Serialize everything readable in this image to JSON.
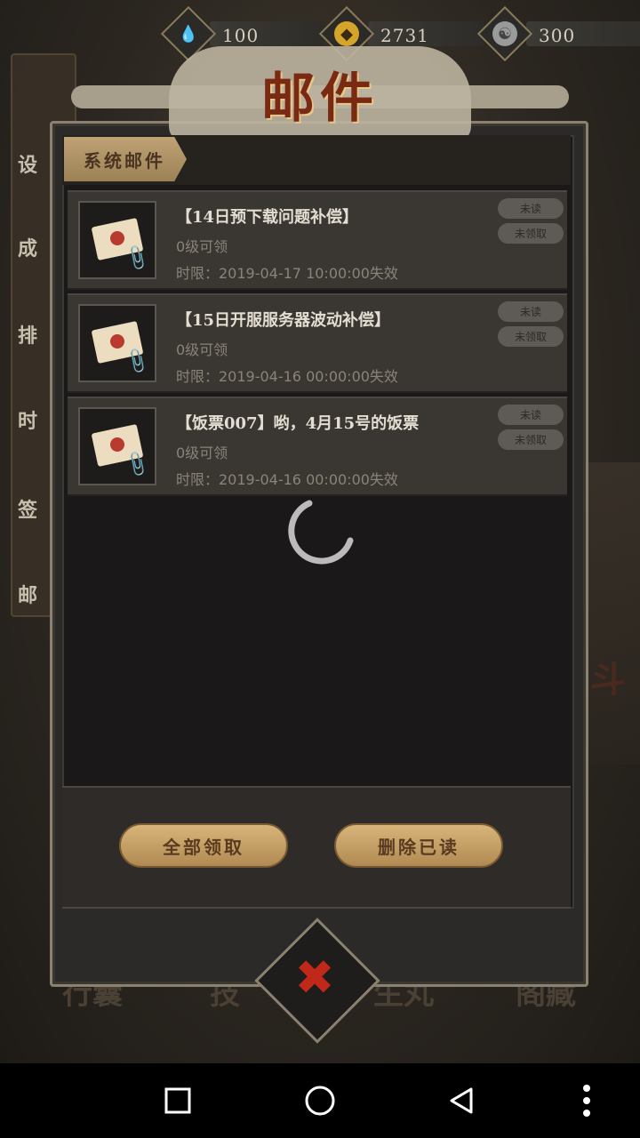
{
  "resources": [
    {
      "name": "stamina",
      "icon": "leaf-drop-icon",
      "value": "100",
      "color": "#3fbf3a"
    },
    {
      "name": "coins",
      "icon": "coin-icon",
      "value": "2731",
      "color": "#d4a52a"
    },
    {
      "name": "jade",
      "icon": "jade-icon",
      "value": "300",
      "color": "#bdbdbd"
    }
  ],
  "title": "邮件",
  "tab_label": "系统邮件",
  "mails": [
    {
      "subject": "【14日预下载问题补偿】",
      "level": "0级可领",
      "expire": "时限：2019-04-17 10:00:00失效",
      "read_status": "未读",
      "claim_status": "未领取"
    },
    {
      "subject": "【15日开服服务器波动补偿】",
      "level": "0级可领",
      "expire": "时限：2019-04-16 00:00:00失效",
      "read_status": "未读",
      "claim_status": "未领取"
    },
    {
      "subject": "【饭票007】哟，4月15号的饭票",
      "level": "0级可领",
      "expire": "时限：2019-04-16 00:00:00失效",
      "read_status": "未读",
      "claim_status": "未领取"
    }
  ],
  "buttons": {
    "claim_all": "全部领取",
    "delete_read": "删除已读"
  },
  "background": {
    "left_menu": [
      "设",
      "成",
      "排",
      "时",
      "签",
      "邮"
    ],
    "bottom_labels": [
      "行囊",
      "技",
      "生丸",
      "阁藏"
    ],
    "right_char": "斗"
  },
  "colors": {
    "title": "#7a2a12",
    "button": "#c9a266",
    "close": "#c0281a"
  }
}
